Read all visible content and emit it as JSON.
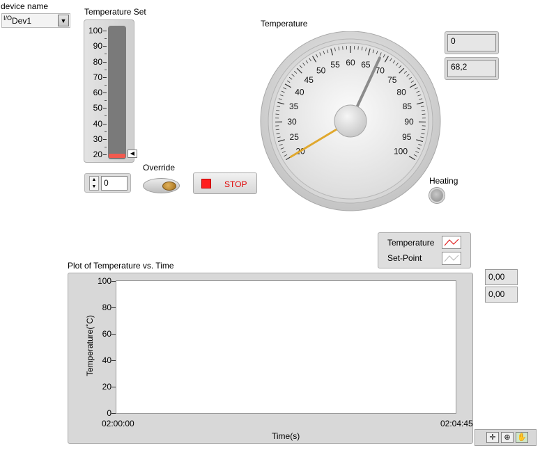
{
  "device": {
    "label": "device name",
    "value": "Dev1",
    "io_icon": "I/O"
  },
  "temperature_set": {
    "label": "Temperature Set",
    "scale": [
      "100",
      "90",
      "80",
      "70",
      "60",
      "50",
      "40",
      "30",
      "20"
    ],
    "level_percent": 0
  },
  "numeric_control": {
    "value": "0"
  },
  "override": {
    "label": "Override"
  },
  "stop_button": {
    "label": "STOP"
  },
  "gauge": {
    "label": "Temperature",
    "ticks": [
      "20",
      "25",
      "30",
      "35",
      "40",
      "45",
      "50",
      "55",
      "60",
      "65",
      "70",
      "75",
      "80",
      "85",
      "90",
      "95",
      "100"
    ],
    "value": 68.2,
    "setpoint": 20
  },
  "indicators": {
    "top": "0",
    "second": "68,2"
  },
  "heating": {
    "label": "Heating"
  },
  "legend": {
    "items": [
      {
        "name": "Temperature",
        "color": "#e02020"
      },
      {
        "name": "Set-Point",
        "color": "#ffffff"
      }
    ]
  },
  "graph": {
    "title": "Plot of Temperature vs. Time",
    "y_label": "Temperature(˚C)",
    "x_label": "Time(s)",
    "y_ticks": [
      "100",
      "80",
      "60",
      "40",
      "20",
      "0"
    ],
    "x_start": "02:00:00",
    "x_end": "02:04:45",
    "cursor_x": "0,00",
    "cursor_y": "0,00"
  },
  "colors": {
    "panel": "#d8d8d8",
    "needle_main": "#8a8a8a",
    "needle_set": "#e0a82e",
    "stop": "#ff1f1f"
  }
}
